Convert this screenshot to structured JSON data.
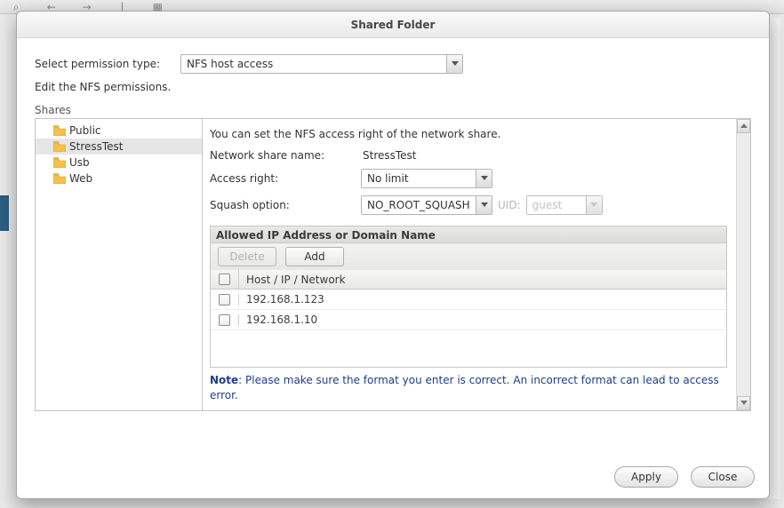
{
  "dialog": {
    "title": "Shared Folder",
    "permission_label": "Select permission type:",
    "permission_value": "NFS host access",
    "edit_help": "Edit the NFS permissions.",
    "shares_label": "Shares"
  },
  "tree": {
    "items": [
      {
        "name": "Public"
      },
      {
        "name": "StressTest"
      },
      {
        "name": "Usb"
      },
      {
        "name": "Web"
      }
    ],
    "selected_index": 1
  },
  "details": {
    "intro": "You can set the NFS access right of the network share.",
    "share_name_label": "Network share name:",
    "share_name_value": "StressTest",
    "access_right_label": "Access right:",
    "access_right_value": "No limit",
    "squash_label": "Squash option:",
    "squash_value": "NO_ROOT_SQUASH",
    "uid_label": "UID:",
    "uid_value": "guest"
  },
  "ip_panel": {
    "title": "Allowed IP Address or Domain Name",
    "delete_label": "Delete",
    "add_label": "Add",
    "column": "Host / IP / Network",
    "rows": [
      {
        "host": "192.168.1.123"
      },
      {
        "host": "192.168.1.10"
      }
    ],
    "note_label": "Note",
    "note_text": ": Please make sure the format you enter is correct. An incorrect format can lead to access error."
  },
  "footer": {
    "apply": "Apply",
    "close": "Close"
  }
}
